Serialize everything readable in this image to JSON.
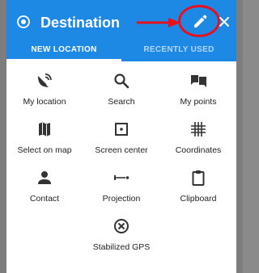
{
  "dialog": {
    "title": "Destination",
    "tabs": [
      "NEW LOCATION",
      "RECENTLY USED"
    ],
    "active_tab": 0
  },
  "options": [
    {
      "label": "My location",
      "icon": "satellite-dish-icon"
    },
    {
      "label": "Search",
      "icon": "magnifier-icon"
    },
    {
      "label": "My points",
      "icon": "points-folders-icon"
    },
    {
      "label": "Select on map",
      "icon": "folded-map-icon"
    },
    {
      "label": "Screen center",
      "icon": "center-square-icon"
    },
    {
      "label": "Coordinates",
      "icon": "coordinate-grid-icon"
    },
    {
      "label": "Contact",
      "icon": "person-icon"
    },
    {
      "label": "Projection",
      "icon": "projection-line-icon"
    },
    {
      "label": "Clipboard",
      "icon": "clipboard-icon"
    },
    {
      "label": "Stabilized GPS",
      "icon": "gps-cross-circle-icon"
    }
  ],
  "colors": {
    "header": "#1e88e5",
    "annotation": "#e8101c",
    "icon": "#333333"
  }
}
